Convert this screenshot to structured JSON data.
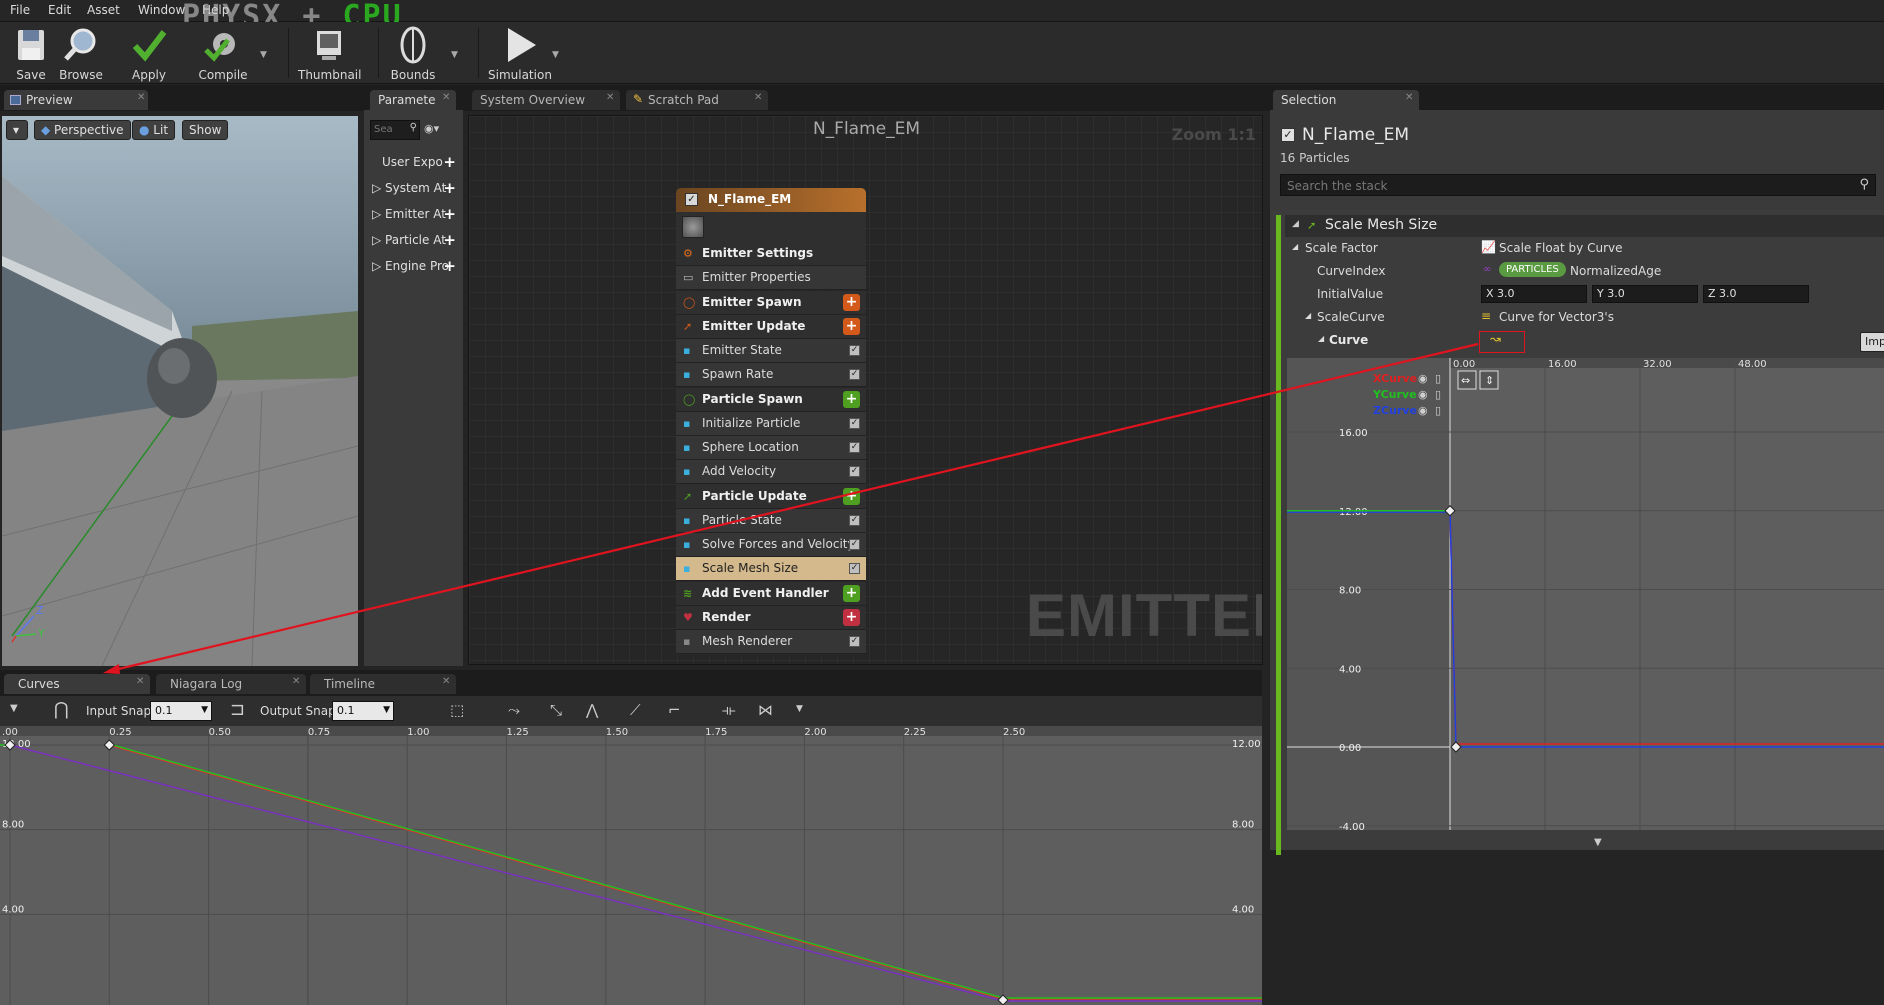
{
  "menu": {
    "file": "File",
    "edit": "Edit",
    "asset": "Asset",
    "window": "Window",
    "help": "Help"
  },
  "banner": {
    "part1": "PHYSX + ",
    "part2": "CPU"
  },
  "toolbar": {
    "save": "Save",
    "browse": "Browse",
    "apply": "Apply",
    "compile": "Compile",
    "thumbnail": "Thumbnail",
    "bounds": "Bounds",
    "simulation": "Simulation"
  },
  "tabs": {
    "preview": "Preview",
    "parameters": "Paramete",
    "system_overview": "System Overview",
    "scratch_pad": "Scratch Pad",
    "selection": "Selection",
    "curves": "Curves",
    "niagara_log": "Niagara Log",
    "timeline": "Timeline"
  },
  "viewport": {
    "perspective": "Perspective",
    "lit": "Lit",
    "show": "Show",
    "axis_z": "Z",
    "axis_y": "Y"
  },
  "parameters": {
    "search_placeholder": "Sea",
    "items": [
      "User Expo",
      "System At",
      "Emitter At",
      "Particle At",
      "Engine Pro"
    ]
  },
  "graph": {
    "title": "N_Flame_EM",
    "zoom": "Zoom 1:1",
    "watermark": "EMITTER"
  },
  "node": {
    "name": "N_Flame_EM",
    "rows": [
      {
        "label": "Emitter Settings",
        "kind": "header",
        "icon": "settings-icon"
      },
      {
        "label": "Emitter Properties",
        "kind": "plain",
        "icon": "cpu-icon"
      },
      {
        "label": "Emitter Spawn",
        "kind": "header-add",
        "icon": "spawn-icon",
        "color": "#d35a1a"
      },
      {
        "label": "Emitter Update",
        "kind": "header-add",
        "icon": "update-icon",
        "color": "#d35a1a"
      },
      {
        "label": "Emitter State",
        "kind": "check",
        "icon": "module-icon"
      },
      {
        "label": "Spawn Rate",
        "kind": "check",
        "icon": "module-icon"
      },
      {
        "label": "Particle Spawn",
        "kind": "header-add",
        "icon": "spawn-icon",
        "color": "#4fa020"
      },
      {
        "label": "Initialize Particle",
        "kind": "check",
        "icon": "module-icon"
      },
      {
        "label": "Sphere Location",
        "kind": "check",
        "icon": "module-icon"
      },
      {
        "label": "Add Velocity",
        "kind": "check",
        "icon": "module-icon"
      },
      {
        "label": "Particle Update",
        "kind": "header-add",
        "icon": "update-icon",
        "color": "#4fa020"
      },
      {
        "label": "Particle State",
        "kind": "check",
        "icon": "module-icon"
      },
      {
        "label": "Solve Forces and Velocity",
        "kind": "check",
        "icon": "module-icon"
      },
      {
        "label": "Scale Mesh Size",
        "kind": "check-selected",
        "icon": "module-icon"
      },
      {
        "label": "Add Event Handler",
        "kind": "header-add",
        "icon": "event-icon",
        "color": "#4fa020"
      },
      {
        "label": "Render",
        "kind": "header-add",
        "icon": "render-icon",
        "color": "#c03040"
      },
      {
        "label": "Mesh Renderer",
        "kind": "check",
        "icon": "mesh-icon"
      }
    ]
  },
  "curves_toolbar": {
    "input_snap_label": "Input Snap",
    "input_snap_value": "0.1",
    "output_snap_label": "Output Snap",
    "output_snap_value": "0.1"
  },
  "bottom_curve": {
    "x_ticks": [
      ".00",
      "0.25",
      "0.50",
      "0.75",
      "1.00",
      "1.25",
      "1.50",
      "1.75",
      "2.00",
      "2.25",
      "2.50"
    ],
    "y_ticks": [
      "12.00",
      "8.00",
      "4.00"
    ],
    "keys": [
      {
        "x": 0.0,
        "y": 12.0
      },
      {
        "x": 0.25,
        "y": 12.0
      },
      {
        "x": 2.5,
        "y": 0.0
      }
    ],
    "series": [
      {
        "color": "#e03030"
      },
      {
        "color": "#20c020"
      },
      {
        "color": "#2030d0"
      }
    ]
  },
  "selection": {
    "name": "N_Flame_EM",
    "count": "16 Particles",
    "search_placeholder": "Search the stack",
    "module": "Scale Mesh Size",
    "scale_factor_label": "Scale Factor",
    "scale_factor_value": "Scale Float by Curve",
    "curve_index_label": "CurveIndex",
    "curve_index_badge": "PARTICLES",
    "curve_index_value": "NormalizedAge",
    "initial_value_label": "InitialValue",
    "vx": "X 3.0",
    "vy": "Y 3.0",
    "vz": "Z 3.0",
    "scale_curve_label": "ScaleCurve",
    "scale_curve_value": "Curve for Vector3's",
    "curve_label": "Curve",
    "import_button": "Impo"
  },
  "side_curve": {
    "x_ticks": [
      "0.00",
      "16.00",
      "32.00",
      "48.00"
    ],
    "y_ticks": [
      "16.00",
      "12.00",
      "8.00",
      "4.00",
      "0.00",
      "-4.00"
    ],
    "legend": [
      "XCurve",
      "YCurve",
      "ZCurve"
    ],
    "keys": [
      {
        "x": 0.0,
        "y": 12.0
      },
      {
        "x": 0.1,
        "y": 0.0
      }
    ]
  },
  "colors": {
    "accent_orange": "#d35a1a",
    "accent_green": "#4fa020",
    "selected_row": "#d4b98c",
    "annotation_red": "#e0141e"
  }
}
